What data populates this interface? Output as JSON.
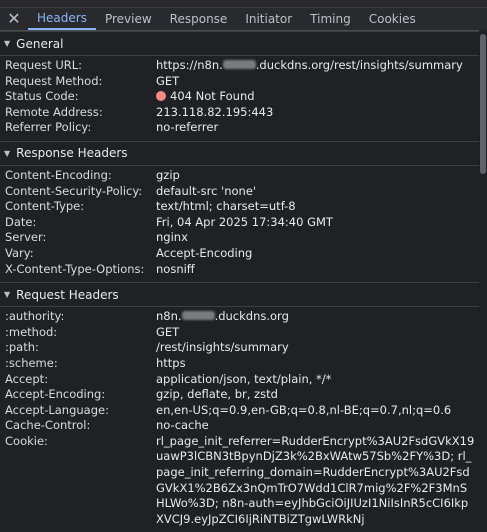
{
  "tabs": [
    "Headers",
    "Preview",
    "Response",
    "Initiator",
    "Timing",
    "Cookies"
  ],
  "general": {
    "title": "General",
    "rows": [
      {
        "k": "Request URL:",
        "v1": "https://n8n.",
        "v2": ".duckdns.org/rest/insights/summary"
      },
      {
        "k": "Request Method:",
        "v": "GET"
      },
      {
        "k": "Status Code:",
        "v": "404 Not Found"
      },
      {
        "k": "Remote Address:",
        "v": "213.118.82.195:443"
      },
      {
        "k": "Referrer Policy:",
        "v": "no-referrer"
      }
    ]
  },
  "response": {
    "title": "Response Headers",
    "rows": [
      {
        "k": "Content-Encoding:",
        "v": "gzip"
      },
      {
        "k": "Content-Security-Policy:",
        "v": "default-src 'none'"
      },
      {
        "k": "Content-Type:",
        "v": "text/html; charset=utf-8"
      },
      {
        "k": "Date:",
        "v": "Fri, 04 Apr 2025 17:34:40 GMT"
      },
      {
        "k": "Server:",
        "v": "nginx"
      },
      {
        "k": "Vary:",
        "v": "Accept-Encoding"
      },
      {
        "k": "X-Content-Type-Options:",
        "v": "nosniff"
      }
    ]
  },
  "request": {
    "title": "Request Headers",
    "rows": [
      {
        "k": ":authority:",
        "v1": "n8n.",
        "v2": ".duckdns.org"
      },
      {
        "k": ":method:",
        "v": "GET"
      },
      {
        "k": ":path:",
        "v": "/rest/insights/summary"
      },
      {
        "k": ":scheme:",
        "v": "https"
      },
      {
        "k": "Accept:",
        "v": "application/json, text/plain, */*"
      },
      {
        "k": "Accept-Encoding:",
        "v": "gzip, deflate, br, zstd"
      },
      {
        "k": "Accept-Language:",
        "v": "en,en-US;q=0.9,en-GB;q=0.8,nl-BE;q=0.7,nl;q=0.6"
      },
      {
        "k": "Cache-Control:",
        "v": "no-cache"
      },
      {
        "k": "Cookie:",
        "v": "rl_page_init_referrer=RudderEncrypt%3AU2FsdGVkX19uawP3lCBN3tBpynDjZ3k%2BxWAtw57Sb%2FY%3D; rl_page_init_referring_domain=RudderEncrypt%3AU2FsdGVkX1%2B6Zx3nQmTrO7Wdd1ClR7mig%2F%2F3MnSHLWo%3D; n8n-auth=eyJhbGciOiJIUzI1NiIsInR5cCI6IkpXVCJ9.eyJpZCI6IjRiNTBiZTgwLWRkNj"
      }
    ]
  }
}
